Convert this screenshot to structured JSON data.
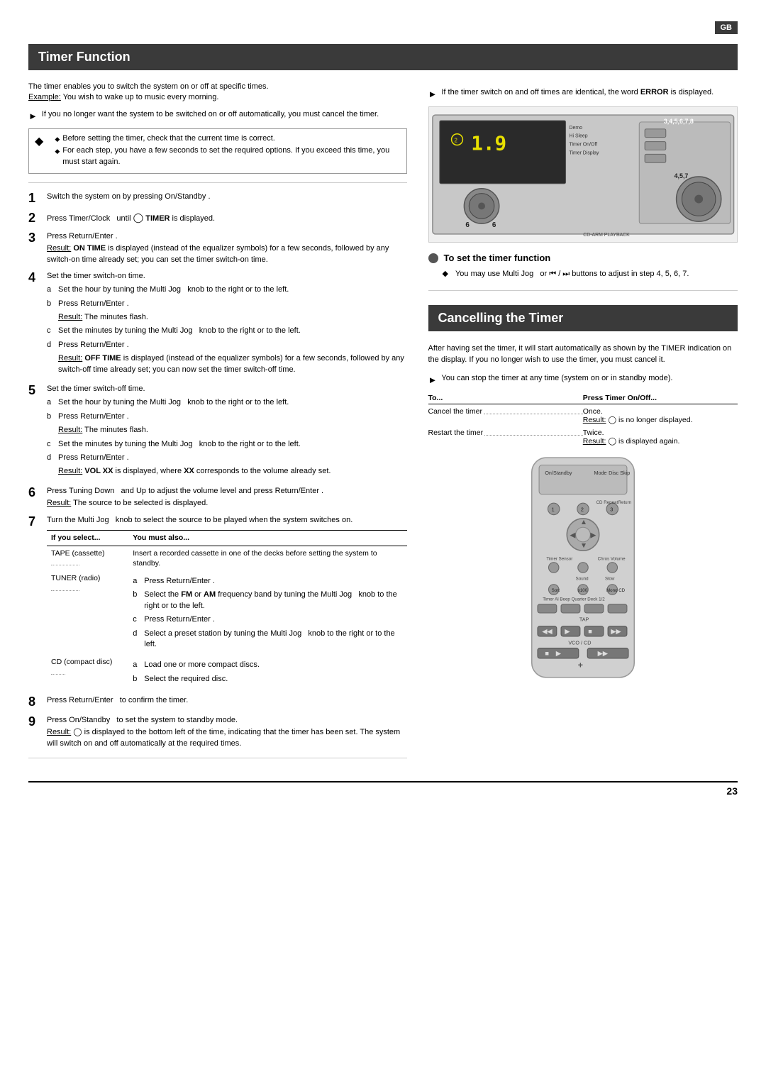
{
  "page": {
    "number": "23",
    "gb_badge": "GB"
  },
  "timer_function": {
    "header": "Timer Function",
    "intro": {
      "line1": "The timer enables you to switch the system on or off at specific times.",
      "example_label": "Example:",
      "example_text": " You wish to wake up to music every morning."
    },
    "arrow_note1": "If you no longer want the system to be switched on or off automatically, you must cancel the timer.",
    "speaker_note_bullets": [
      "Before setting the timer, check that the current time is correct.",
      "For each step, you have a few seconds to set the required options. If you exceed this time, you must start again."
    ],
    "steps": [
      {
        "num": "1",
        "text": "Switch the system on by pressing On/Standby ."
      },
      {
        "num": "2",
        "text": "Press Timer/Clock  until   TIMER is displayed."
      },
      {
        "num": "3",
        "text": "Press Return/Enter .",
        "result_label": "Result:",
        "result_text": " ON TIME is displayed (instead of the equalizer symbols) for a few seconds, followed by any switch-on time already set; you can set the timer switch-on time."
      },
      {
        "num": "4",
        "text": "Set the timer switch-on time.",
        "substeps": [
          {
            "letter": "a",
            "text": "Set the hour by tuning the Multi Jog  knob to the right or to the left."
          },
          {
            "letter": "b",
            "text": "Press Return/Enter ."
          },
          {
            "letter": "",
            "text": "Result: The minutes flash.",
            "is_result": true
          },
          {
            "letter": "c",
            "text": "Set the minutes by tuning the Multi Jog  knob to the right or to the left."
          },
          {
            "letter": "d",
            "text": "Press Return/Enter ."
          },
          {
            "letter": "",
            "text": "Result: OFF TIME is displayed (instead of the equalizer symbols) for a few seconds, followed by any switch-off time already set; you can now set the timer switch-off time.",
            "is_result": true
          }
        ]
      },
      {
        "num": "5",
        "text": "Set the timer switch-off time.",
        "substeps": [
          {
            "letter": "a",
            "text": "Set the hour by tuning the Multi Jog  knob to the right or to the left."
          },
          {
            "letter": "b",
            "text": "Press Return/Enter ."
          },
          {
            "letter": "",
            "text": "Result: The minutes flash.",
            "is_result": true
          },
          {
            "letter": "c",
            "text": "Set the minutes by tuning the Multi Jog  knob to the right or to the left."
          },
          {
            "letter": "d",
            "text": "Press Return/Enter ."
          },
          {
            "letter": "",
            "text": "Result: VOL XX is displayed, where XX corresponds to the volume already set.",
            "is_result": true
          }
        ]
      },
      {
        "num": "6",
        "text": "Press Tuning Down  and Up to adjust the volume level and press Return/Enter .",
        "result_label": "Result:",
        "result_text": " The source to be selected is displayed."
      },
      {
        "num": "7",
        "text": "Turn the Multi Jog  knob to select the source to be played when the system switches on.",
        "has_table": true
      },
      {
        "num": "8",
        "text": "Press Return/Enter  to confirm the timer."
      },
      {
        "num": "9",
        "text": "Press On/Standby  to set the system to standby mode.",
        "result_label": "Result:",
        "result_text": "  is displayed to the bottom left of the time, indicating that the timer has been set. The system will switch on and off automatically at the required times."
      }
    ],
    "select_table": {
      "col1": "If you select...",
      "col2": "You must also...",
      "rows": [
        {
          "source": "TAPE (cassette)",
          "instruction": "Insert a recorded cassette in one of the decks before setting the system to standby."
        },
        {
          "source": "TUNER (radio)",
          "substeps": [
            {
              "letter": "a",
              "text": "Press Return/Enter ."
            },
            {
              "letter": "b",
              "text": "Select the FM or AM frequency band by tuning the Multi Jog  knob to the right or to the left."
            },
            {
              "letter": "c",
              "text": "Press Return/Enter ."
            },
            {
              "letter": "d",
              "text": "Select a preset station by tuning the Multi Jog  knob to the right or to the left."
            }
          ]
        },
        {
          "source": "CD (compact disc)",
          "substeps": [
            {
              "letter": "a",
              "text": "Load one or more compact discs."
            },
            {
              "letter": "b",
              "text": "Select the required disc."
            }
          ]
        }
      ]
    }
  },
  "right_column": {
    "error_note": "If the timer switch on and off times are identical, the word ERROR is displayed.",
    "timer_function_note_title": "To set the timer function",
    "timer_function_note_text": "You may use Multi Jog  or  /  buttons to adjust in step 4, 5, 6, 7."
  },
  "cancelling_timer": {
    "header": "Cancelling the Timer",
    "desc1": "After having set the timer, it will start automatically as shown by the TIMER indication on the display. If you no longer wish to use the timer, you must cancel it.",
    "arrow_note": "You can stop the timer at any time (system on or in standby mode).",
    "table": {
      "col1": "To...",
      "col2": "Press Timer On/Off...",
      "rows": [
        {
          "action": "Cancel the timer",
          "press": "Once.",
          "result_label": "Result:",
          "result_text": "  is no longer displayed."
        },
        {
          "action": "Restart the timer",
          "press": "Twice.",
          "result_label": "Result:",
          "result_text": "  is displayed again."
        }
      ]
    }
  }
}
